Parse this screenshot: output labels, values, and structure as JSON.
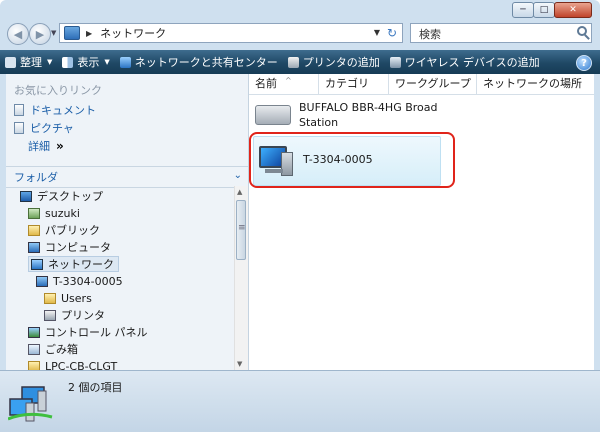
{
  "window": {
    "min_label": "─",
    "max_label": "□",
    "close_label": "✕"
  },
  "address": {
    "path": "ネットワーク",
    "search_placeholder": "検索"
  },
  "toolbar": {
    "organize": "整理",
    "view": "表示",
    "network_center": "ネットワークと共有センター",
    "add_printer": "プリンタの追加",
    "add_wireless": "ワイヤレス デバイスの追加",
    "help": "?"
  },
  "favorites": {
    "title": "お気に入りリンク",
    "items": [
      "ドキュメント",
      "ピクチャ"
    ],
    "details": "詳細",
    "details_arrows": "»"
  },
  "folders": {
    "title": "フォルダ",
    "tree": [
      {
        "label": "デスクトップ",
        "icon": "desktop-icon"
      },
      {
        "label": "suzuki",
        "icon": "user-folder-icon"
      },
      {
        "label": "パブリック",
        "icon": "folder-icon"
      },
      {
        "label": "コンピュータ",
        "icon": "computer-icon"
      },
      {
        "label": "ネットワーク",
        "icon": "network-icon"
      },
      {
        "label": "T-3304-0005",
        "icon": "computer-icon"
      },
      {
        "label": "Users",
        "icon": "shared-folder-icon"
      },
      {
        "label": "プリンタ",
        "icon": "printer-icon"
      },
      {
        "label": "コントロール パネル",
        "icon": "control-panel-icon"
      },
      {
        "label": "ごみ箱",
        "icon": "recycle-bin-icon"
      },
      {
        "label": "LPC-CB-CLGT",
        "icon": "folder-icon"
      }
    ]
  },
  "columns": [
    "名前",
    "カテゴリ",
    "ワークグループ",
    "ネットワークの場所"
  ],
  "files": [
    {
      "line1": "BUFFALO BBR-4HG Broad",
      "line2": "Station",
      "icon": "router-icon"
    },
    {
      "line1": "T-3304-0005",
      "icon": "computer-icon"
    }
  ],
  "status": {
    "count_text": "2 個の項目"
  },
  "colors": {
    "toolbar": "#1f4865",
    "link": "#1c5fa8",
    "highlight": "#e0241a"
  }
}
